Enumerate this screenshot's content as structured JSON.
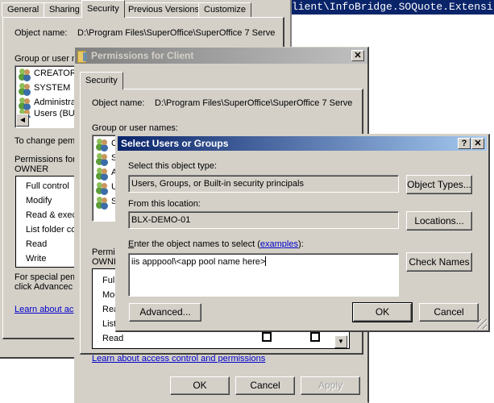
{
  "console": {
    "text": "lient\\InfoBridge.SOQuote.Extensi"
  },
  "properties_window": {
    "tabs": [
      {
        "label": "General",
        "active": false
      },
      {
        "label": "Sharing",
        "active": false
      },
      {
        "label": "Security",
        "active": true
      },
      {
        "label": "Previous Versions",
        "active": false
      },
      {
        "label": "Customize",
        "active": false
      }
    ],
    "object_name_label": "Object name:",
    "object_name_value": "D:\\Program Files\\SuperOffice\\SuperOffice 7 Serve",
    "group_label": "Group or user n",
    "users": [
      {
        "name": "CREATOR",
        "icon": "users-icon"
      },
      {
        "name": "SYSTEM",
        "icon": "users-icon"
      },
      {
        "name": "Administra",
        "icon": "users-icon"
      },
      {
        "name": "Users (BU",
        "icon": "users-icon"
      }
    ],
    "change_perm_text": "To change pem",
    "permissions_for_label_line1": "Permissions for",
    "permissions_for_label_line2": "OWNER",
    "permissions": [
      "Full control",
      "Modify",
      "Read & exec",
      "List folder co",
      "Read",
      "Write"
    ],
    "special_text_line1": "For special pem",
    "special_text_line2": "click Advancec",
    "learn_link": "Learn about ac"
  },
  "permissions_window": {
    "title": "Permissions for Client",
    "tab": "Security",
    "object_name_label": "Object name:",
    "object_name_value": "D:\\Program Files\\SuperOffice\\SuperOffice 7 Serve",
    "group_label": "Group or user names:",
    "users": [
      {
        "name": "C",
        "icon": "users-icon"
      },
      {
        "name": "S",
        "icon": "users-icon"
      },
      {
        "name": "A",
        "icon": "users-icon"
      },
      {
        "name": "U",
        "icon": "users-icon"
      },
      {
        "name": "S",
        "icon": "users-icon"
      }
    ],
    "permissions_for_label_line1": "Permis",
    "permissions_for_label_line2": "OWNI",
    "permissions": [
      {
        "label": "Full",
        "allow": null,
        "deny": null
      },
      {
        "label": "Moc",
        "allow": null,
        "deny": null
      },
      {
        "label": "Rea",
        "allow": null,
        "deny": null
      },
      {
        "label": "List",
        "allow": null,
        "deny": null
      },
      {
        "label": "Read",
        "allow": false,
        "deny": false
      }
    ],
    "learn_link": "Learn about access control and permissions",
    "buttons": {
      "ok": "OK",
      "cancel": "Cancel",
      "apply": "Apply"
    },
    "close_glyph": "✕"
  },
  "select_dialog": {
    "title": "Select Users or Groups",
    "help_glyph": "?",
    "close_glyph": "✕",
    "object_type_label": "Select this object type:",
    "object_type_value": "Users, Groups, or Built-in security principals",
    "object_types_button": "Object Types...",
    "location_label": "From this location:",
    "location_value": "BLX-DEMO-01",
    "locations_button": "Locations...",
    "enter_label_accesskey": "E",
    "enter_label_rest": "nter the object names to select (",
    "examples_link": "examples",
    "enter_label_end": "):",
    "names_value": "iis apppool\\<app pool name here>",
    "check_names_button": "Check Names",
    "advanced_button": "Advanced...",
    "ok_button": "OK",
    "cancel_button": "Cancel"
  }
}
